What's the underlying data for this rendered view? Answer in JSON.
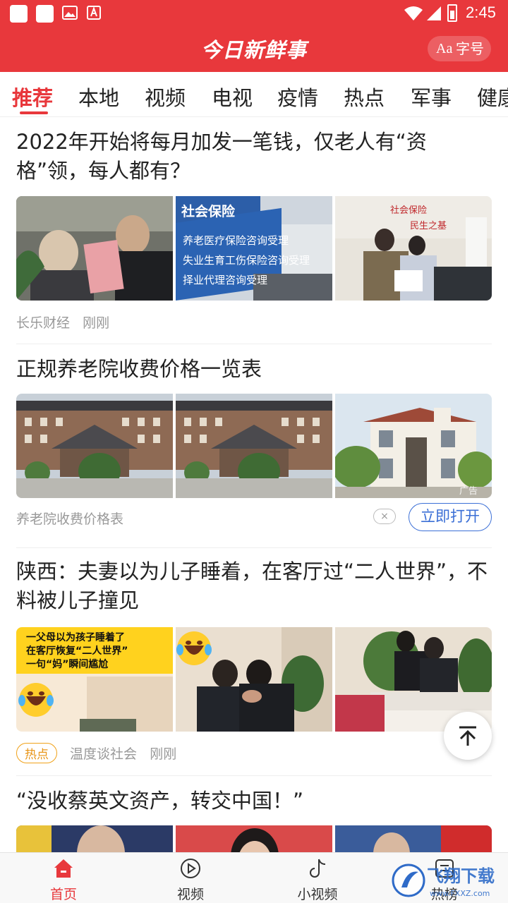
{
  "status_bar": {
    "time": "2:45"
  },
  "header": {
    "brand": "今日新鲜事",
    "font_button_icon": "Aa",
    "font_button_label": "字号"
  },
  "tabs": [
    {
      "label": "推荐",
      "active": true
    },
    {
      "label": "本地"
    },
    {
      "label": "视频"
    },
    {
      "label": "电视"
    },
    {
      "label": "疫情"
    },
    {
      "label": "热点"
    },
    {
      "label": "军事"
    },
    {
      "label": "健康"
    }
  ],
  "articles": [
    {
      "title": "2022年开始将每月加发一笔钱，仅老人有“资格”领，每人都有？",
      "source": "长乐财经",
      "time": "刚刚"
    },
    {
      "title": "正规养老院收费价格一览表",
      "source": "养老院收费价格表",
      "ad_action": "立即打开",
      "ad_close": "×",
      "ad_tag": "广告"
    },
    {
      "title": "陕西：夫妻以为儿子睡着，在客厅过“二人世界”，不料被儿子撞见",
      "badge": "热点",
      "source": "温度谈社会",
      "time": "刚刚",
      "thumb1_caption": [
        "一父母以为孩子睡着了",
        "在客厅恢复“二人世界”",
        "一句“妈”瞬间尴尬"
      ]
    },
    {
      "title": "“没收蔡英文资产，转交中国！”"
    }
  ],
  "image_text": {
    "pension1": "社会保险",
    "pension2": "养老医疗保险咨询受理",
    "pension3": "失业生育工伤保险咨询受理",
    "pension4": "择业代理咨询受理",
    "pension_wall": "社会保险",
    "pension_wall2": "民生之基"
  },
  "bottom_nav": [
    {
      "label": "首页",
      "icon": "home-icon",
      "active": true
    },
    {
      "label": "视频",
      "icon": "play-icon"
    },
    {
      "label": "小视频",
      "icon": "music-note-icon"
    },
    {
      "label": "热榜",
      "icon": "hot-list-icon"
    }
  ],
  "watermark": {
    "text": "飞翔下载",
    "url": "www.FXXZ.com"
  },
  "colors": {
    "brand_red": "#e8383c",
    "link_blue": "#3b6fd6",
    "hot_orange": "#f0a21a"
  }
}
